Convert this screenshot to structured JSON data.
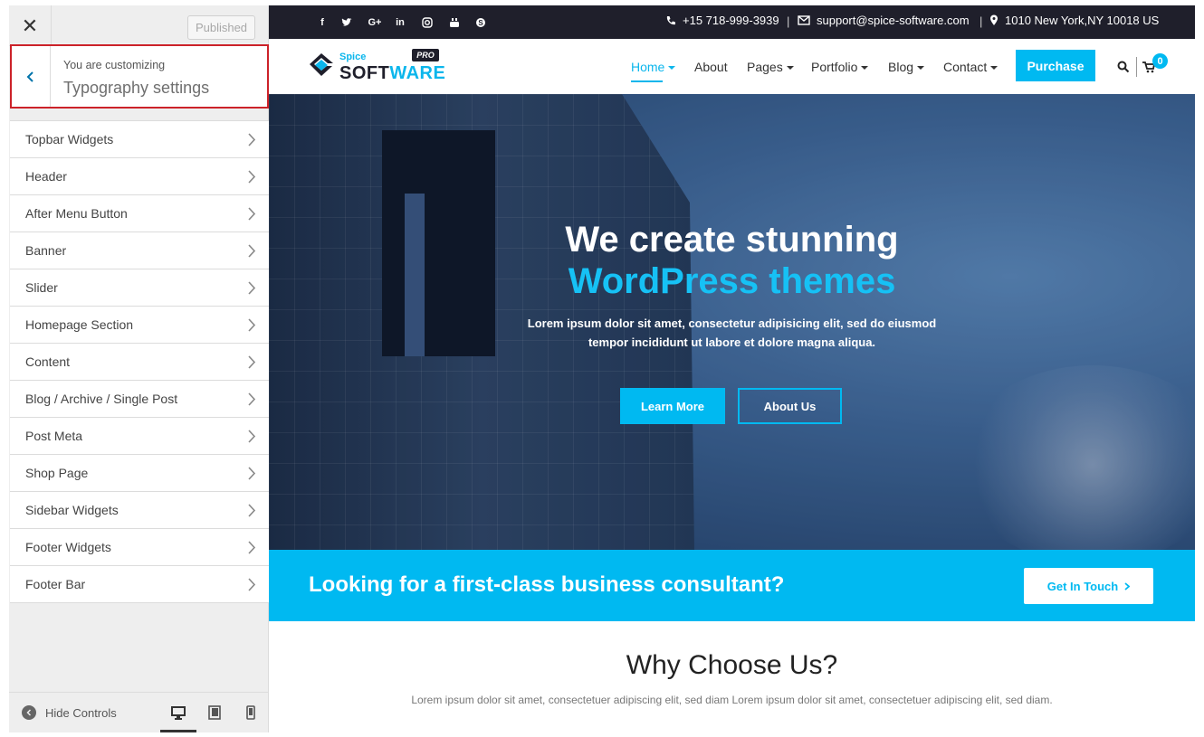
{
  "customizer": {
    "published_label": "Published",
    "close_icon": "close-icon",
    "you_are_customizing": "You are customizing",
    "section_title": "Typography settings",
    "highlight_color": "#cc2229",
    "menu": [
      {
        "label": "Topbar Widgets"
      },
      {
        "label": "Header"
      },
      {
        "label": "After Menu Button"
      },
      {
        "label": "Banner"
      },
      {
        "label": "Slider"
      },
      {
        "label": "Homepage Section"
      },
      {
        "label": "Content"
      },
      {
        "label": "Blog / Archive / Single Post"
      },
      {
        "label": "Post Meta"
      },
      {
        "label": "Shop Page"
      },
      {
        "label": "Sidebar Widgets"
      },
      {
        "label": "Footer Widgets"
      },
      {
        "label": "Footer Bar"
      }
    ],
    "hide_controls_label": "Hide Controls",
    "devices": [
      "desktop-icon",
      "tablet-icon",
      "mobile-icon"
    ],
    "active_device": "desktop"
  },
  "site": {
    "accent_color": "#00b9f1",
    "topbar": {
      "social_icons": [
        "facebook-icon",
        "twitter-icon",
        "google-plus-icon",
        "linkedin-icon",
        "instagram-icon",
        "youtube-icon",
        "skype-icon"
      ],
      "phone": "+15 718-999-3939",
      "email": "support@spice-software.com",
      "address": "1010 New York,NY 10018 US"
    },
    "logo": {
      "spice": "Spice",
      "software_a": "SOFT",
      "software_b": "WARE",
      "badge": "PRO"
    },
    "nav": {
      "items": [
        "Home",
        "About",
        "Pages",
        "Portfolio",
        "Blog",
        "Contact"
      ],
      "purchase_label": "Purchase",
      "cart_count": "0"
    },
    "hero": {
      "line1": "We create stunning",
      "line2": "WordPress themes",
      "desc1": "Lorem ipsum dolor sit amet, consectetur adipisicing elit, sed do eiusmod",
      "desc2": "tempor incididunt ut labore et dolore magna aliqua.",
      "btn1": "Learn More",
      "btn2": "About Us"
    },
    "cta": {
      "text": "Looking for a first-class business consultant?",
      "button": "Get In Touch"
    },
    "why": {
      "title": "Why Choose Us?",
      "text": "Lorem ipsum dolor sit amet, consectetuer adipiscing elit, sed diam Lorem ipsum dolor sit amet, consectetuer adipiscing elit, sed diam."
    }
  }
}
